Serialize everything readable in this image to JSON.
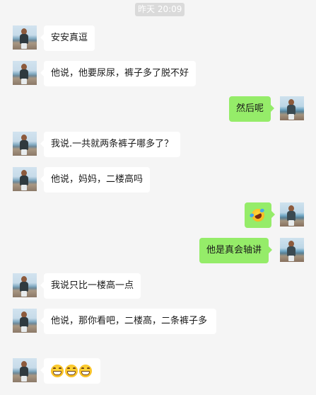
{
  "timestamp": "昨天 20:09",
  "messages": [
    {
      "side": "left",
      "text": "安安真逗"
    },
    {
      "side": "left",
      "text": "他说，他要尿尿，裤子多了脱不好"
    },
    {
      "side": "right",
      "text": "然后呢"
    },
    {
      "side": "left",
      "text": "我说.一共就两条裤子哪多了？"
    },
    {
      "side": "left",
      "text": "他说，妈妈，二楼高吗"
    },
    {
      "side": "right",
      "emoji": "laughing-rolling-emoji"
    },
    {
      "side": "right",
      "text": "他是真会轴讲"
    },
    {
      "side": "left",
      "text": "我说只比一楼高一点"
    },
    {
      "side": "left",
      "text": "他说，那你看吧，二楼高，二条裤子多"
    },
    {
      "side": "left",
      "emoji": "grinning-emoji x3"
    }
  ]
}
